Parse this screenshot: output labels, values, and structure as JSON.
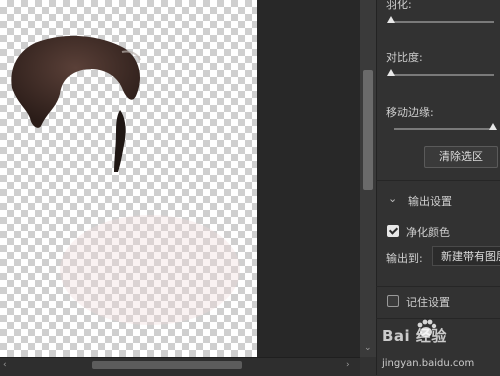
{
  "panel": {
    "feather_label": "羽化:",
    "feather_value": 0,
    "contrast_label": "对比度:",
    "contrast_value": 0,
    "shift_edge_label": "移动边缘:",
    "shift_edge_value": 1,
    "clear_selection_button": "清除选区",
    "output_section_title": "输出设置",
    "decontaminate_label": "净化颜色",
    "decontaminate_checked": true,
    "output_to_label": "输出到:",
    "output_to_value": "新建带有图层蒙版的图层",
    "remember_label": "记住设置",
    "remember_checked": false
  },
  "watermark": {
    "brand": "Bai 经验",
    "url": "jingyan.baidu.com"
  },
  "colors": {
    "panel_bg": "#323232",
    "workspace_bg": "#282828",
    "hair": "#3a2a26"
  },
  "icons": [
    "chevron-down-icon",
    "checkmark-icon",
    "baidu-paw-icon",
    "scroll-arrow-right-icon"
  ]
}
